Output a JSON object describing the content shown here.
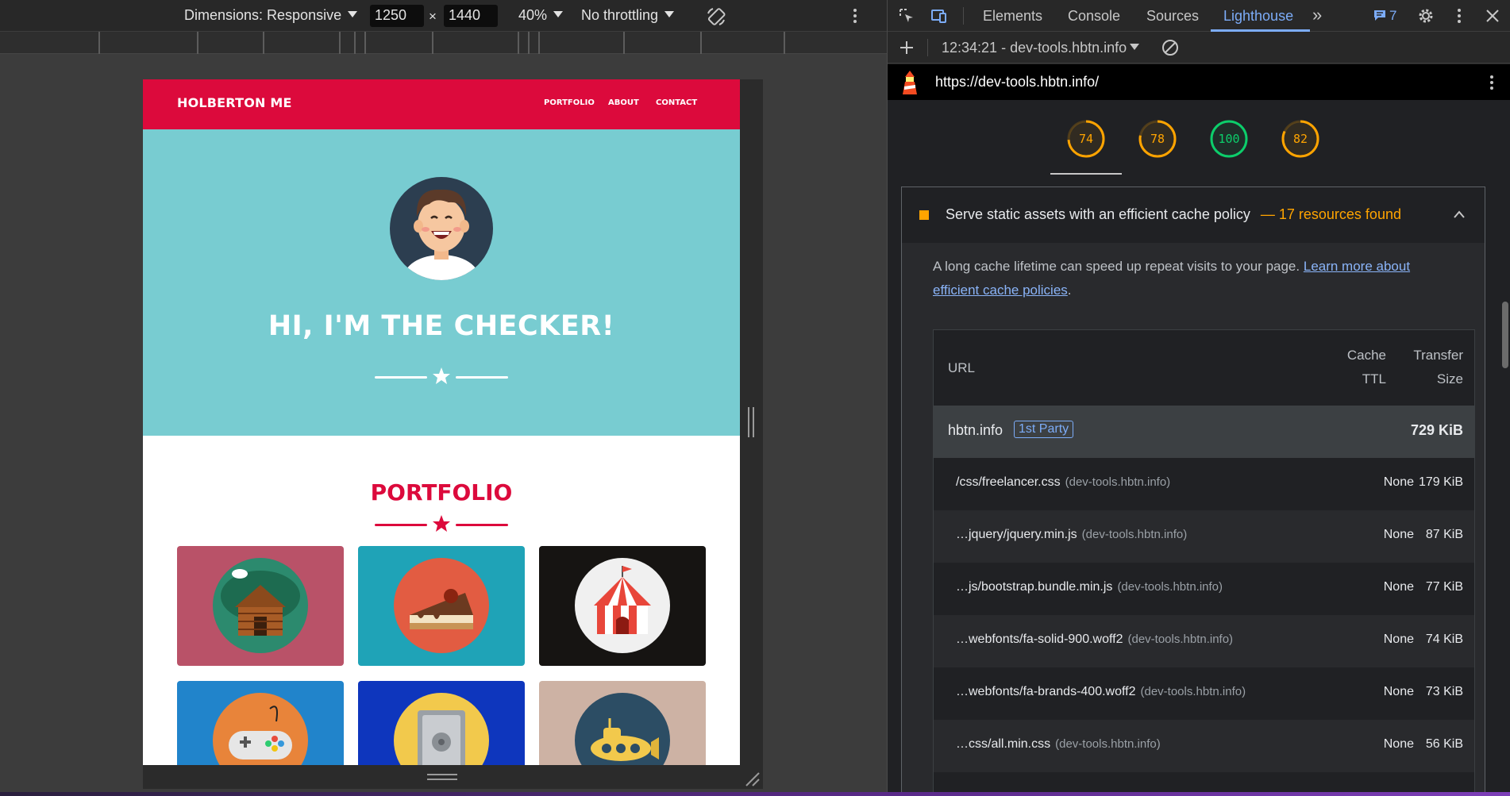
{
  "device_toolbar": {
    "dimensions_label": "Dimensions: Responsive",
    "width_value": "1250",
    "times": "×",
    "height_value": "1440",
    "zoom": "40%",
    "throttling": "No throttling"
  },
  "site": {
    "brand": "HOLBERTON ME",
    "nav": [
      "PORTFOLIO",
      "ABOUT",
      "CONTACT"
    ],
    "hero_title": "HI, I'M THE CHECKER!",
    "portfolio_title": "PORTFOLIO",
    "colors": {
      "nav": "#dc0a3c",
      "hero": "#78ccd1"
    }
  },
  "devtools": {
    "tabs": [
      "Elements",
      "Console",
      "Sources",
      "Lighthouse"
    ],
    "active_tab": "Lighthouse",
    "issues_count": "7",
    "report_label": "12:34:21 - dev-tools.hbtn.info",
    "url": "https://dev-tools.hbtn.info/",
    "scores": [
      "74",
      "78",
      "100",
      "82"
    ],
    "audit": {
      "title": "Serve static assets with an efficient cache policy",
      "summary": "— 17 resources found",
      "description": "A long cache lifetime can speed up repeat visits to your page.",
      "link_text": "Learn more about efficient cache policies",
      "period": "."
    },
    "table": {
      "col_url": "URL",
      "col_cache_1": "Cache",
      "col_cache_2": "TTL",
      "col_size_1": "Transfer",
      "col_size_2": "Size",
      "group": {
        "name": "hbtn.info",
        "badge": "1st Party",
        "size": "729 KiB"
      },
      "rows": [
        {
          "url": "/css/freelancer.css",
          "host": "(dev-tools.hbtn.info)",
          "ttl": "None",
          "size": "179 KiB"
        },
        {
          "url": "…jquery/jquery.min.js",
          "host": "(dev-tools.hbtn.info)",
          "ttl": "None",
          "size": "87 KiB"
        },
        {
          "url": "…js/bootstrap.bundle.min.js",
          "host": "(dev-tools.hbtn.info)",
          "ttl": "None",
          "size": "77 KiB"
        },
        {
          "url": "…webfonts/fa-solid-900.woff2",
          "host": "(dev-tools.hbtn.info)",
          "ttl": "None",
          "size": "74 KiB"
        },
        {
          "url": "…webfonts/fa-brands-400.woff2",
          "host": "(dev-tools.hbtn.info)",
          "ttl": "None",
          "size": "73 KiB"
        },
        {
          "url": "…css/all.min.css",
          "host": "(dev-tools.hbtn.info)",
          "ttl": "None",
          "size": "56 KiB"
        }
      ]
    },
    "colors": {
      "accent": "#7cacf8",
      "average": "#ffa400",
      "pass": "#0cce6b"
    }
  }
}
